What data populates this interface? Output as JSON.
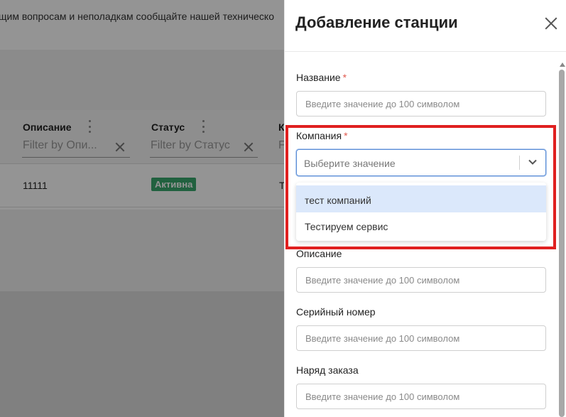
{
  "background": {
    "notice_text": "щим вопросам и неполадкам сообщайте нашей техническо",
    "table": {
      "columns": [
        {
          "header": "Описание",
          "filter_placeholder": "Filter by Опи..."
        },
        {
          "header": "Статус",
          "filter_placeholder": "Filter by Статус"
        },
        {
          "header": "К",
          "filter_placeholder": "F"
        }
      ],
      "row": {
        "description": "11111",
        "status": "Активна",
        "company_partial": "Т"
      }
    }
  },
  "drawer": {
    "title": "Добавление станции",
    "fields": {
      "name": {
        "label": "Название",
        "required": "*",
        "placeholder": "Введите значение до 100 символом"
      },
      "company": {
        "label": "Компания",
        "required": "*",
        "placeholder": "Выберите значение"
      },
      "description": {
        "label": "Описание",
        "placeholder": "Введите значение до 100 символом"
      },
      "serial": {
        "label": "Серийный номер",
        "placeholder": "Введите значение до 100 символом"
      },
      "order": {
        "label": "Наряд заказа",
        "placeholder": "Введите значение до 100 символом"
      }
    },
    "company_options": [
      "тест компаний",
      "Тестируем сервис"
    ]
  },
  "colors": {
    "accent": "#5a8dd6",
    "status_green": "#3aa76d",
    "highlight_red": "#e02020",
    "required_red": "#e05a4f"
  }
}
